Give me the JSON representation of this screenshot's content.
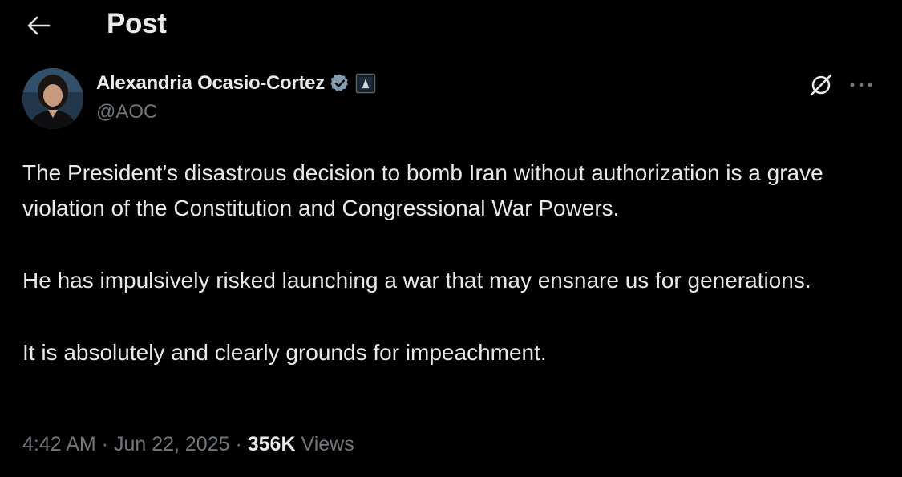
{
  "header": {
    "title": "Post",
    "back_icon": "arrow-left-icon"
  },
  "author": {
    "display_name": "Alexandria Ocasio-Cortez",
    "handle": "@AOC",
    "verified_icon": "verified-badge-icon",
    "affiliation_icon": "government-badge-icon",
    "avatar": "avatar"
  },
  "actions": {
    "grok_icon": "grok-icon",
    "more_icon": "more-options-icon"
  },
  "post": {
    "paragraphs": [
      "The President’s disastrous decision to bomb Iran without authorization is a grave violation of the Constitution and Congressional War Powers.",
      "He has impulsively risked launching a war that may ensnare us for generations.",
      "It is absolutely and clearly grounds for impeachment."
    ]
  },
  "meta": {
    "time": "4:42 AM",
    "separator": " · ",
    "date": "Jun 22, 2025",
    "views_count": "356K",
    "views_label": "Views"
  },
  "colors": {
    "background": "#000000",
    "text_primary": "#e7e9ea",
    "text_secondary": "#71767b",
    "verified": "#829aab"
  }
}
